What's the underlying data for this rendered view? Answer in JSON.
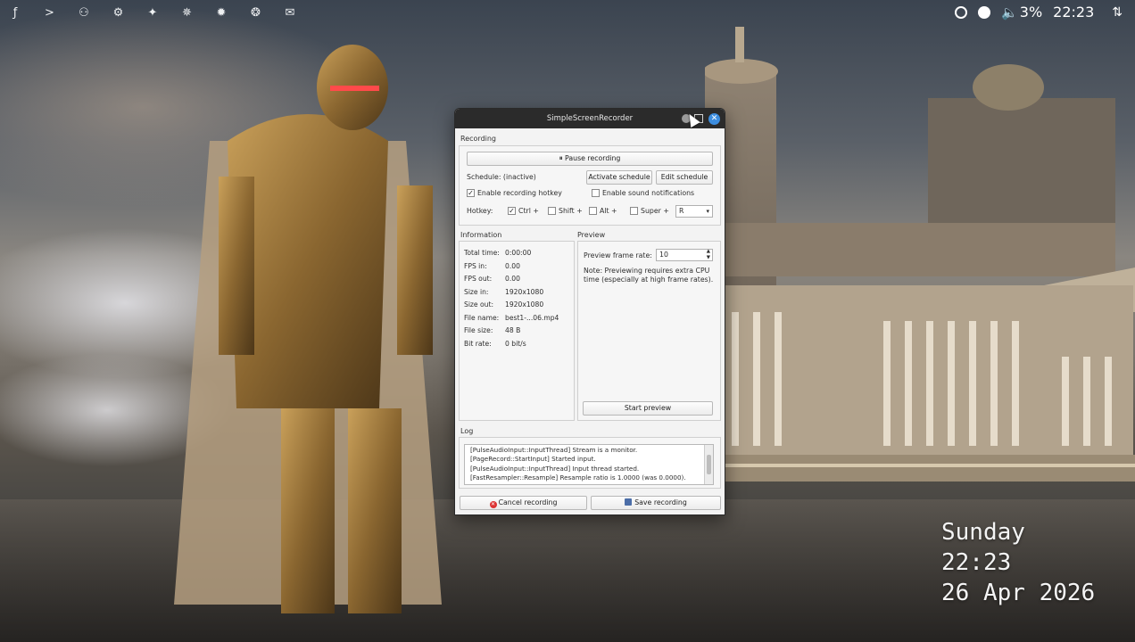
{
  "panel": {
    "launchers": [
      {
        "icon": "function-icon",
        "glyph": "ƒ"
      },
      {
        "icon": "terminal-icon",
        "glyph": ">"
      },
      {
        "icon": "screenshot-icon",
        "glyph": "⚇"
      },
      {
        "icon": "settings-gear-icon",
        "glyph": "⚙"
      },
      {
        "icon": "move-icon",
        "glyph": "✦"
      },
      {
        "icon": "brightness-icon",
        "glyph": "✵"
      },
      {
        "icon": "sun-icon",
        "glyph": "✹"
      },
      {
        "icon": "aperture-icon",
        "glyph": "❂"
      },
      {
        "icon": "mail-icon",
        "glyph": "✉"
      }
    ],
    "volume_percent": "3%",
    "clock": "22:23"
  },
  "desktop_clock": {
    "day": "Sunday",
    "time": "22:23",
    "date": "26 Apr 2026"
  },
  "window": {
    "title": "SimpleScreenRecorder",
    "recording": {
      "heading": "Recording",
      "pause_button": "Pause recording",
      "schedule_label": "Schedule: (inactive)",
      "activate_schedule": "Activate schedule",
      "edit_schedule": "Edit schedule",
      "enable_hotkey": "Enable recording hotkey",
      "enable_hotkey_checked": true,
      "enable_sound": "Enable sound notifications",
      "enable_sound_checked": false,
      "hotkey_label": "Hotkey:",
      "mods": [
        {
          "label": "Ctrl +",
          "checked": true
        },
        {
          "label": "Shift +",
          "checked": false
        },
        {
          "label": "Alt +",
          "checked": false
        },
        {
          "label": "Super +",
          "checked": false
        }
      ],
      "key": "R"
    },
    "information": {
      "heading": "Information",
      "rows": [
        {
          "key": "Total time:",
          "value": "0:00:00"
        },
        {
          "key": "FPS in:",
          "value": "0.00"
        },
        {
          "key": "FPS out:",
          "value": "0.00"
        },
        {
          "key": "Size in:",
          "value": "1920x1080"
        },
        {
          "key": "Size out:",
          "value": "1920x1080"
        },
        {
          "key": "File name:",
          "value": "best1-...06.mp4"
        },
        {
          "key": "File size:",
          "value": "48 B"
        },
        {
          "key": "Bit rate:",
          "value": "0 bit/s"
        }
      ]
    },
    "preview": {
      "heading": "Preview",
      "frame_rate_label": "Preview frame rate:",
      "frame_rate_value": "10",
      "note": "Note: Previewing requires extra CPU",
      "note2": "time (especially at high frame rates).",
      "start_button": "Start preview"
    },
    "log": {
      "heading": "Log",
      "lines": [
        "[PulseAudioInput::InputThread] Stream is a monitor.",
        "[PageRecord::StartInput] Started input.",
        "[PulseAudioInput::InputThread] Input thread started.",
        "[FastResampler::Resample] Resample ratio is 1.0000 (was 0.0000)."
      ]
    },
    "cancel_button": "Cancel recording",
    "save_button": "Save recording"
  }
}
